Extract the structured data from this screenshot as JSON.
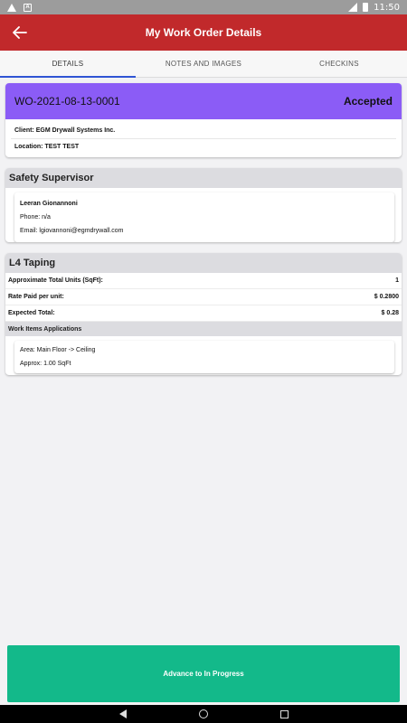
{
  "status_bar": {
    "time": "11:50"
  },
  "app_bar": {
    "title": "My Work Order Details",
    "back_icon": "arrow-left-icon"
  },
  "tabs": [
    {
      "label": "DETAILS",
      "active": true
    },
    {
      "label": "NOTES AND IMAGES",
      "active": false
    },
    {
      "label": "CHECKINS",
      "active": false
    }
  ],
  "work_order": {
    "id": "WO-2021-08-13-0001",
    "status": "Accepted",
    "client": "Client: EGM Drywall Systems Inc.",
    "location": "Location: TEST TEST",
    "header_color": "#8b5cf6"
  },
  "safety_supervisor": {
    "heading": "Safety Supervisor",
    "name": "Leeran Gionannoni",
    "phone": "Phone: n/a",
    "email": "Email: lgiovannoni@egmdrywall.com"
  },
  "line_item": {
    "heading": "L4 Taping",
    "rows": [
      {
        "label": "Approximate Total Units (SqFt):",
        "value": "1"
      },
      {
        "label": "Rate Paid per unit:",
        "value": "$ 0.2800"
      },
      {
        "label": "Expected Total:",
        "value": "$ 0.28"
      }
    ],
    "applications_heading": "Work Items Applications",
    "applications": [
      {
        "area": "Area: Main Floor -> Ceiling",
        "approx": "Approx: 1.00 SqFt"
      }
    ]
  },
  "actions": {
    "advance_label": "Advance to In Progress",
    "button_color": "#13b98a"
  },
  "colors": {
    "app_bar": "#c1292b",
    "tab_indicator": "#2f55d4"
  }
}
